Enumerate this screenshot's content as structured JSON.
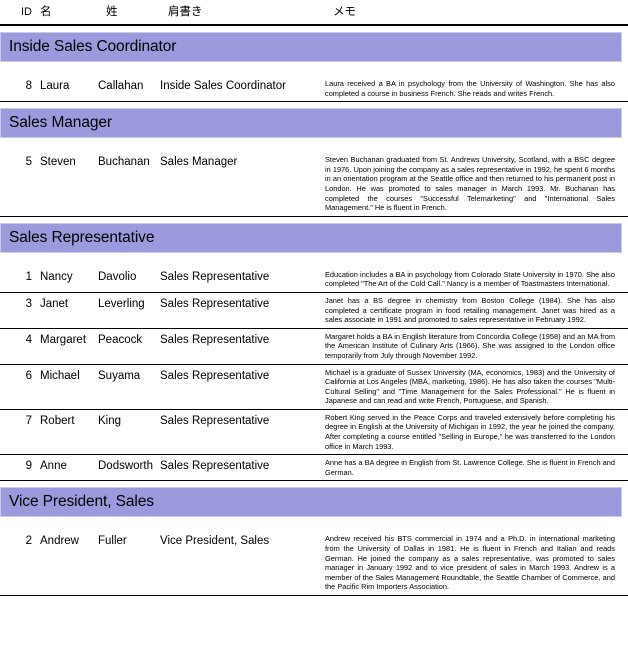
{
  "report": {
    "columns": [
      {
        "key": "id",
        "label": "ID"
      },
      {
        "key": "first",
        "label": "名"
      },
      {
        "key": "last",
        "label": "姓"
      },
      {
        "key": "title",
        "label": "肩書き"
      },
      {
        "key": "notes",
        "label": "メモ"
      }
    ],
    "accent_color": "#9a9add",
    "groups": [
      {
        "title": "Inside Sales Coordinator",
        "rows": [
          {
            "id": "8",
            "first": "Laura",
            "last": "Callahan",
            "title": "Inside Sales Coordinator",
            "notes": "Laura received a BA in psychology from the University of Washington.  She has also completed a course in business French.  She reads and writes French."
          }
        ]
      },
      {
        "title": "Sales Manager",
        "rows": [
          {
            "id": "5",
            "first": "Steven",
            "last": "Buchanan",
            "title": "Sales Manager",
            "notes": "Steven Buchanan graduated from St. Andrews University, Scotland, with a BSC degree in 1976.  Upon joining the company as a sales representative in 1992, he spent 6 months in an orientation program at the Seattle office and then returned to his permanent post in London.  He was promoted to sales manager in March 1993.  Mr. Buchanan has completed the courses \"Successful Telemarketing\" and \"International Sales Management.\"  He is fluent in French."
          }
        ]
      },
      {
        "title": "Sales Representative",
        "rows": [
          {
            "id": "1",
            "first": "Nancy",
            "last": "Davolio",
            "title": "Sales Representative",
            "notes": "Education includes a BA in psychology from Colorado State University in 1970.  She also completed \"The Art of the Cold Call.\"   Nancy is a member of Toastmasters International."
          },
          {
            "id": "3",
            "first": "Janet",
            "last": "Leverling",
            "title": "Sales Representative",
            "notes": "Janet has a BS degree in chemistry from Boston College (1984).  She has also completed a certificate program in food retailing management.  Janet was hired as a sales associate in 1991 and promoted to sales representative in February 1992."
          },
          {
            "id": "4",
            "first": "Margaret",
            "last": "Peacock",
            "title": "Sales Representative",
            "notes": "Margaret holds a BA in English literature from Concordia College (1958) and an MA from the American Institute of Culinary Arts (1966).  She was assigned to the London office temporarily from July through November 1992."
          },
          {
            "id": "6",
            "first": "Michael",
            "last": "Suyama",
            "title": "Sales Representative",
            "notes": "Michael is a graduate of Sussex University (MA, economics, 1983) and the University of California at Los Angeles (MBA, marketing, 1986).  He has also taken the courses \"Multi-Cultural Selling\" and \"Time Management for the Sales Professional.\"   He is fluent in Japanese and can read and write French, Portuguese, and Spanish."
          },
          {
            "id": "7",
            "first": "Robert",
            "last": "King",
            "title": "Sales Representative",
            "notes": "Robert King served in the Peace Corps and traveled extensively before completing his degree in English at the University of Michigan in 1992, the year he joined the company.   After completing a course entitled \"Selling in Europe,\" he was transferred to the London office in March 1993."
          },
          {
            "id": "9",
            "first": "Anne",
            "last": "Dodsworth",
            "title": "Sales Representative",
            "notes": "Anne has a BA degree in English from St. Lawrence College.  She is fluent in French and German."
          }
        ]
      },
      {
        "title": "Vice President, Sales",
        "rows": [
          {
            "id": "2",
            "first": "Andrew",
            "last": "Fuller",
            "title": "Vice President, Sales",
            "notes": "Andrew received his BTS commercial in 1974 and a Ph.D. in international marketing from the University of Dallas in 1981.  He is fluent in French and Italian and reads German.   He joined the company as a sales representative, was promoted to sales manager in January 1992 and to vice president of sales in March 1993.  Andrew is a member of the Sales Management Roundtable, the Seattle Chamber of Commerce, and the Pacific Rim Importers Association."
          }
        ]
      }
    ]
  }
}
